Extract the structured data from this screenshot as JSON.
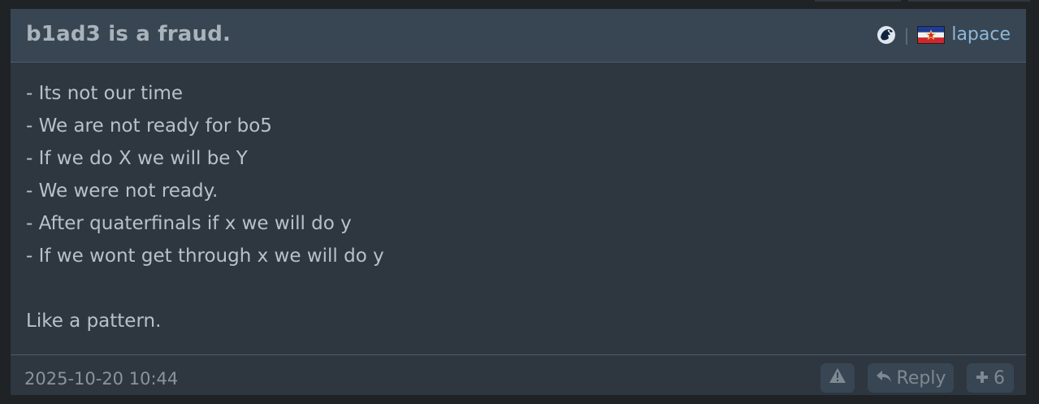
{
  "post": {
    "title": "b1ad3 is a fraud.",
    "author": {
      "name": "lapace",
      "separator": "|",
      "team_icon": "team-liquid-horse-icon",
      "flag_icon": "yugoslavia-flag-icon"
    },
    "body_lines": [
      "- Its not our time",
      "- We are not ready for bo5",
      "- If we do X we will be Y",
      "- We were not ready.",
      "- After quaterfinals if x we will do y",
      "- If we wont get through x we will do y",
      "Like a pattern."
    ],
    "timestamp": "2025-10-20 10:44",
    "actions": {
      "report_icon": "warning-icon",
      "reply_label": "Reply",
      "reply_icon": "reply-arrow-icon",
      "plus_label": "6",
      "plus_icon": "plus-icon"
    }
  },
  "colors": {
    "page_bg": "#1f2326",
    "post_bg": "#2e3640",
    "header_bg": "#384653",
    "title": "#aab3bb",
    "author_link": "#8fb7d8",
    "body_text": "#b8c1c8",
    "muted": "#7d8992"
  }
}
